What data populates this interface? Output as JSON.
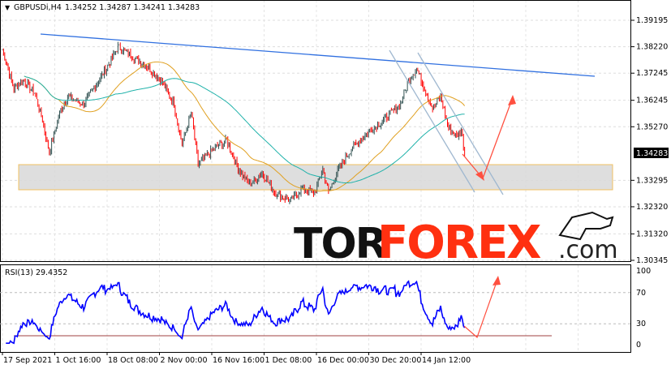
{
  "header": {
    "symbol": "GBPUSDi,H4",
    "ohlc": "1.34252 1.34287 1.34241 1.34283"
  },
  "price_axis": [
    "1.39195",
    "1.38220",
    "1.37245",
    "1.36245",
    "1.35270",
    "1.33295",
    "1.32320",
    "1.31320",
    "1.30345"
  ],
  "current_price": "1.34283",
  "rsi": {
    "label": "RSI(13) 29.4352",
    "levels": [
      "100",
      "70",
      "30",
      "0"
    ]
  },
  "time_axis": [
    "17 Sep 2021",
    "1 Oct 16:00",
    "18 Oct 08:00",
    "2 Nov 00:00",
    "16 Nov 16:00",
    "1 Dec 08:00",
    "16 Dec 00:00",
    "30 Dec 20:00",
    "14 Jan 12:00"
  ],
  "watermark": {
    "part1": "TOR",
    "part2": "FOREX",
    "part3": ".com"
  },
  "colors": {
    "bull": "#2f4f4f",
    "bear": "#ff0000",
    "ma_fast": "#e0a020",
    "ma_slow": "#20b2aa",
    "trend": "#3070e0",
    "arrow": "#ff5040",
    "rsi": "#0000ff"
  },
  "chart_data": {
    "type": "line",
    "title": "GBPUSDi,H4",
    "ylim": [
      1.30345,
      1.39195
    ],
    "price_waypoints": [
      [
        0,
        1.38102
      ],
      [
        10,
        1.36683
      ],
      [
        18,
        1.36979
      ],
      [
        28,
        1.36536
      ],
      [
        35,
        1.35501
      ],
      [
        41,
        1.34319
      ],
      [
        50,
        1.35797
      ],
      [
        57,
        1.36388
      ],
      [
        71,
        1.36092
      ],
      [
        82,
        1.36831
      ],
      [
        93,
        1.3757
      ],
      [
        101,
        1.3822
      ],
      [
        114,
        1.37865
      ],
      [
        128,
        1.37422
      ],
      [
        139,
        1.36979
      ],
      [
        150,
        1.36092
      ],
      [
        157,
        1.34615
      ],
      [
        165,
        1.35797
      ],
      [
        171,
        1.33876
      ],
      [
        185,
        1.34467
      ],
      [
        196,
        1.34762
      ],
      [
        206,
        1.33728
      ],
      [
        216,
        1.33137
      ],
      [
        227,
        1.3358
      ],
      [
        238,
        1.32842
      ],
      [
        252,
        1.32546
      ],
      [
        262,
        1.3299
      ],
      [
        273,
        1.32842
      ],
      [
        280,
        1.33728
      ],
      [
        285,
        1.32842
      ],
      [
        294,
        1.33728
      ],
      [
        305,
        1.34467
      ],
      [
        319,
        1.35058
      ],
      [
        333,
        1.35501
      ],
      [
        348,
        1.36092
      ],
      [
        355,
        1.36979
      ],
      [
        362,
        1.37422
      ],
      [
        369,
        1.36683
      ],
      [
        376,
        1.35944
      ],
      [
        383,
        1.36388
      ],
      [
        390,
        1.35206
      ],
      [
        397,
        1.3491
      ],
      [
        401,
        1.35206
      ],
      [
        404,
        1.34283
      ]
    ],
    "ma_periods": [
      50,
      100
    ],
    "rsi_period": 13,
    "rsi_ylim": [
      0,
      100
    ]
  }
}
